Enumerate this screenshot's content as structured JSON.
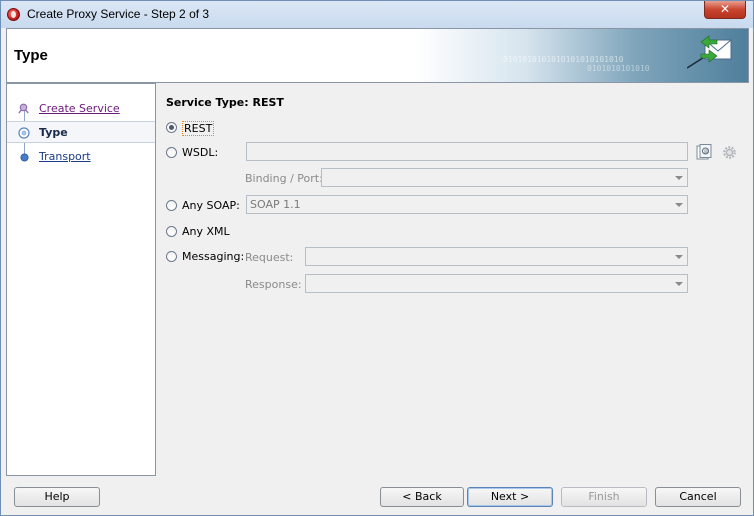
{
  "window": {
    "title": "Create Proxy Service - Step 2 of 3",
    "close_glyph": "✕"
  },
  "header": {
    "title": "Type",
    "decor_binary_1": "0101010101010101010101010",
    "decor_binary_2": "0101010101010",
    "icon": "envelope-arrows-icon"
  },
  "steps": [
    {
      "label": "Create Service",
      "state": "visited"
    },
    {
      "label": "Type",
      "state": "active"
    },
    {
      "label": "Transport",
      "state": "pending"
    }
  ],
  "form": {
    "section_title": "Service Type: REST",
    "options": {
      "rest": {
        "label": "REST",
        "selected": true
      },
      "wsdl": {
        "label": "WSDL:",
        "selected": false
      },
      "any_soap": {
        "label": "Any SOAP:",
        "selected": false
      },
      "any_xml": {
        "label": "Any XML",
        "selected": false
      },
      "messaging": {
        "label": "Messaging:",
        "selected": false
      }
    },
    "wsdl_value": "",
    "binding_port_label": "Binding / Port:",
    "binding_port_value": "",
    "soap_version_value": "SOAP 1.1",
    "request_label": "Request:",
    "request_value": "",
    "response_label": "Response:",
    "response_value": ""
  },
  "buttons": {
    "help": "Help",
    "back": "< Back",
    "next": "Next >",
    "finish": "Finish",
    "cancel": "Cancel"
  },
  "colors": {
    "link": "#1a3a8c",
    "visited_link": "#6a1a7a",
    "focus_border": "#e08a20"
  }
}
